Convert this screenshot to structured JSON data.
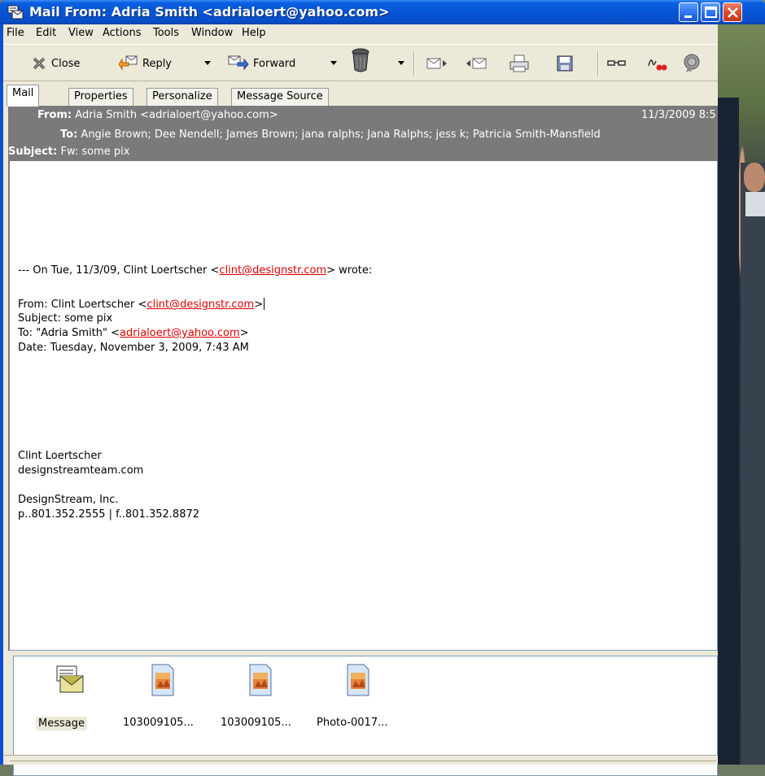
{
  "window": {
    "title": "Mail From: Adria Smith <adrialoert@yahoo.com>",
    "title_color": "#0653d6"
  },
  "menu": [
    "File",
    "Edit",
    "View",
    "Actions",
    "Tools",
    "Window",
    "Help"
  ],
  "toolbar": {
    "close_label": "Close",
    "reply_label": "Reply",
    "forward_label": "Forward",
    "icons": [
      "close-x-icon",
      "reply-icon",
      "forward-icon",
      "trash-can-icon",
      "next-message-icon",
      "previous-message-icon",
      "print-icon",
      "save-icon",
      "glasses-icon",
      "signature-icon",
      "seal-icon"
    ]
  },
  "tabs": [
    "Mail",
    "Properties",
    "Personalize",
    "Message Source"
  ],
  "header": {
    "from_label": "From:",
    "from_value": "Adria Smith <adrialoert@yahoo.com>",
    "date": "11/3/2009 8:5",
    "to_label": "To:",
    "to_value": "Angie Brown; Dee Nendell; James Brown; jana ralphs; Jana Ralphs; jess k; Patricia Smith-Mansfield",
    "subject_label": "Subject:",
    "subject_value": "Fw: some pix",
    "bg_color": "#7a7a7a"
  },
  "body": {
    "wrote_prefix": "--- On Tue, 11/3/09, Clint Loertscher <",
    "wrote_link": "clint@designstr.com",
    "wrote_suffix": "> wrote:",
    "from_prefix": "From: Clint Loertscher <",
    "from_link": "clint@designstr.com",
    "from_suffix": ">",
    "subject_line": "Subject: some pix",
    "to_prefix": "To: \"Adria Smith\" <",
    "to_link": "adrialoert@yahoo.com",
    "to_suffix": ">",
    "date_line": "Date: Tuesday, November 3, 2009, 7:43 AM",
    "sig_name": "Clint Loertscher",
    "sig_site": "designstreamteam.com",
    "sig_company": "DesignStream, Inc.",
    "sig_phone": "p..801.352.2555 | f..801.352.8872",
    "link_color": "#e00000"
  },
  "attachments": [
    {
      "label": "Message",
      "icon": "message-envelope-icon"
    },
    {
      "label": "103009105...",
      "icon": "image-file-icon"
    },
    {
      "label": "103009105...",
      "icon": "image-file-icon"
    },
    {
      "label": "Photo-0017...",
      "icon": "image-file-icon"
    }
  ]
}
